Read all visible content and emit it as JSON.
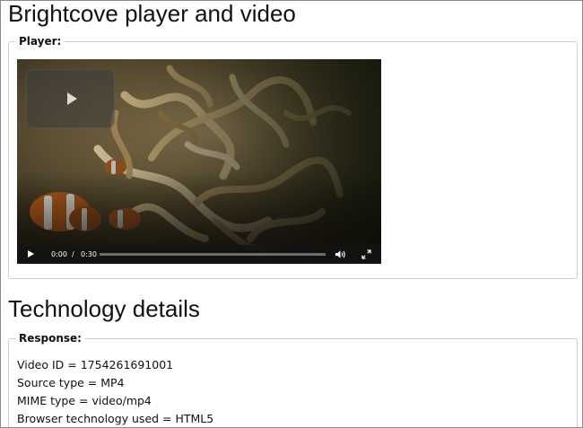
{
  "page": {
    "title": "Brightcove player and video",
    "tech_title": "Technology details"
  },
  "player_section": {
    "legend": "Player:",
    "controls": {
      "current_time": "0:00",
      "separator": "/",
      "duration": "0:30",
      "progress": 0,
      "icons": [
        "play-icon",
        "big-play-icon",
        "volume-icon",
        "fullscreen-icon"
      ]
    }
  },
  "response_section": {
    "legend": "Response:",
    "lines": [
      "Video ID = 1754261691001",
      "Source type = MP4",
      "MIME type = video/mp4",
      "Browser technology used = HTML5"
    ]
  },
  "colors": {
    "control_bar": "#141414",
    "border": "#cfcfcf"
  }
}
